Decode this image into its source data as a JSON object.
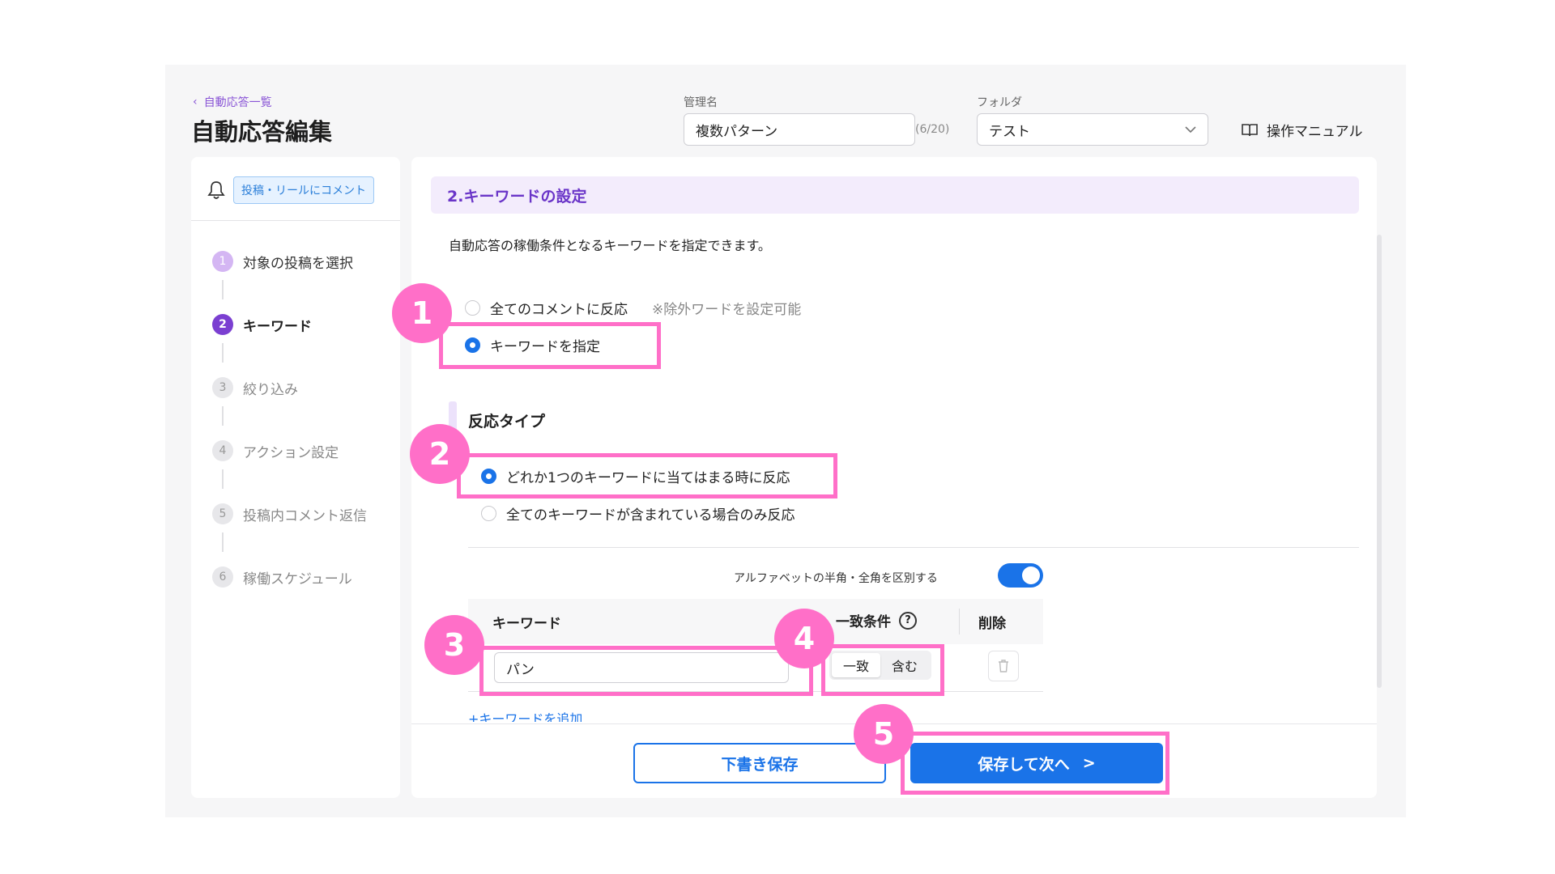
{
  "header": {
    "back_label": "自動応答一覧",
    "title": "自動応答編集",
    "name_label": "管理名",
    "name_value": "複数パターン",
    "name_counter": "(6/20)",
    "folder_label": "フォルダ",
    "folder_value": "テスト",
    "manual_label": "操作マニュアル"
  },
  "sidebar": {
    "trigger_badge": "投稿・リールにコメント",
    "steps": [
      {
        "num": "1",
        "label": "対象の投稿を選択",
        "state": "done"
      },
      {
        "num": "2",
        "label": "キーワード",
        "state": "active"
      },
      {
        "num": "3",
        "label": "絞り込み",
        "state": "pending"
      },
      {
        "num": "4",
        "label": "アクション設定",
        "state": "pending"
      },
      {
        "num": "5",
        "label": "投稿内コメント返信",
        "state": "pending"
      },
      {
        "num": "6",
        "label": "稼働スケジュール",
        "state": "pending"
      }
    ]
  },
  "main": {
    "section_title": "2.キーワードの設定",
    "description": "自動応答の稼働条件となるキーワードを指定できます。",
    "mode_options": [
      {
        "label": "全てのコメントに反応",
        "note": "※除外ワードを設定可能",
        "selected": false
      },
      {
        "label": "キーワードを指定",
        "selected": true
      }
    ],
    "reaction_title": "反応タイプ",
    "reaction_options": [
      {
        "label": "どれか1つのキーワードに当てはまる時に反応",
        "selected": true
      },
      {
        "label": "全てのキーワードが含まれている場合のみ反応",
        "selected": false
      }
    ],
    "toggle_label": "アルファベットの半角・全角を区別する",
    "toggle_on": true,
    "table": {
      "col_keyword": "キーワード",
      "col_match": "一致条件",
      "col_delete": "削除",
      "help_glyph": "?",
      "row_keyword": "パン",
      "match_options": [
        "一致",
        "含む"
      ],
      "match_selected": "一致"
    },
    "add_keyword": "+キーワードを追加",
    "draft_button": "下書き保存",
    "next_button": "保存して次へ",
    "next_arrow": ">"
  },
  "annotations": [
    "1",
    "2",
    "3",
    "4",
    "5"
  ],
  "colors": {
    "accent": "#1a73e8",
    "purple": "#7b3fd1",
    "highlight": "#ff6fc8"
  }
}
